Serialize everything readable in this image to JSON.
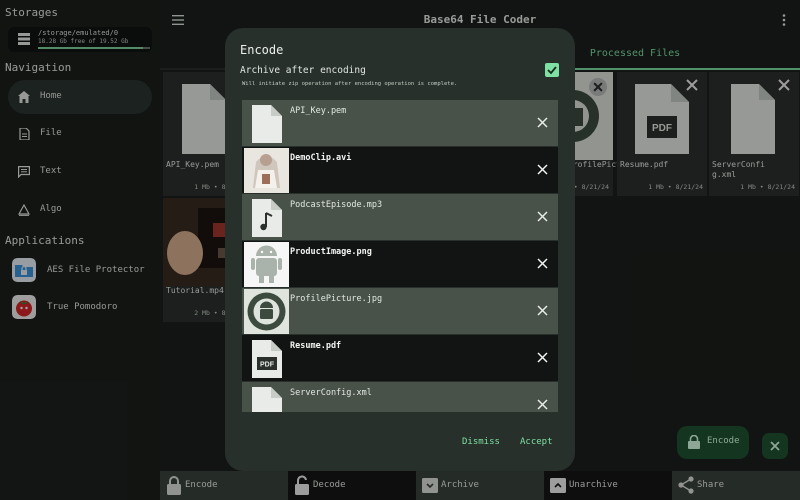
{
  "sidebar": {
    "storages_title": "Storages",
    "storage_path": "/storage/emulated/0",
    "storage_free": "18.28 Gb free of 19.52 Gb",
    "storage_used_fraction": 0.94,
    "navigation_title": "Navigation",
    "nav": [
      {
        "label": "Home",
        "icon": "home-icon"
      },
      {
        "label": "File",
        "icon": "file-icon"
      },
      {
        "label": "Text",
        "icon": "chat-icon"
      },
      {
        "label": "Algo",
        "icon": "algo-icon"
      }
    ],
    "applications_title": "Applications",
    "apps": [
      {
        "label": "AES File Protector",
        "icon": "folder-lock-icon"
      },
      {
        "label": "True Pomodoro",
        "icon": "tomato-icon"
      }
    ]
  },
  "header": {
    "title": "Base64 File Coder",
    "tab_processed": "Processed Files"
  },
  "grid": [
    {
      "name": "API_Key.pem",
      "meta": "1 Mb • 8/21/24"
    },
    {
      "name": "Tutorial.mp4",
      "meta": "2 Mb • 8/21/24"
    },
    {
      "name": "ProfilePicture.jpg",
      "meta": "1 Mb • 8/21/24"
    },
    {
      "name": "Resume.pdf",
      "meta": "1 Mb • 8/21/24"
    },
    {
      "name": "ServerConfig.xml",
      "meta": "1 Mb • 8/21/24"
    }
  ],
  "dialog": {
    "title": "Encode",
    "archive_label": "Archive after encoding",
    "archive_hint": "Will initiate zip operation after encoding operation is complete.",
    "archive_checked": true,
    "files": [
      {
        "name": "API_Key.pem",
        "thumb": "document-icon"
      },
      {
        "name": "DemoClip.avi",
        "thumb": "video-thumbnail"
      },
      {
        "name": "PodcastEpisode.mp3",
        "thumb": "music-note-icon"
      },
      {
        "name": "ProductImage.png",
        "thumb": "image-thumbnail"
      },
      {
        "name": "ProfilePicture.jpg",
        "thumb": "image-thumbnail"
      },
      {
        "name": "Resume.pdf",
        "thumb": "pdf-icon"
      },
      {
        "name": "ServerConfig.xml",
        "thumb": "document-icon"
      }
    ],
    "dismiss": "Dismiss",
    "accept": "Accept"
  },
  "fab": {
    "label": "Encode"
  },
  "bottom": [
    {
      "label": "Encode",
      "icon": "lock-icon"
    },
    {
      "label": "Decode",
      "icon": "unlock-icon"
    },
    {
      "label": "Archive",
      "icon": "archive-icon"
    },
    {
      "label": "Unarchive",
      "icon": "unarchive-icon"
    },
    {
      "label": "Share",
      "icon": "share-icon"
    }
  ],
  "colors": {
    "accent": "#7ee0a3",
    "dialog": "#28302b",
    "fab": "#1f5232"
  }
}
